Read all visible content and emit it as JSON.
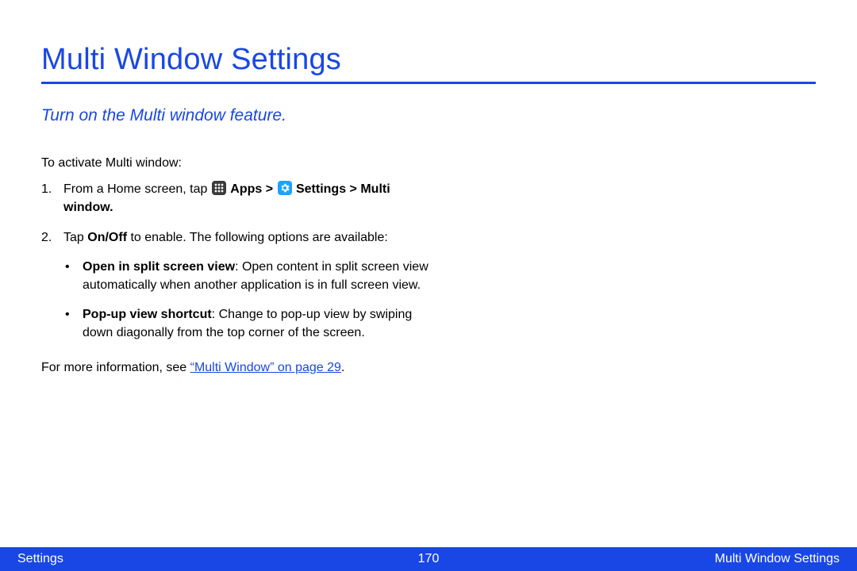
{
  "title": "Multi Window Settings",
  "subtitle": "Turn on the Multi window feature.",
  "intro": "To activate Multi window:",
  "step1": {
    "prefix": "From a Home screen, tap ",
    "apps_label": "Apps",
    "sep1": " > ",
    "settings_label": "Settings",
    "sep2": " > ",
    "multi_window_label": "Multi window."
  },
  "step2": {
    "prefix": "Tap ",
    "onoff_label": "On/Off",
    "suffix": " to enable. The following options are available:"
  },
  "bullets": [
    {
      "label": "Open in split screen view",
      "text": ": Open content in split screen view automatically when another application is in full screen view."
    },
    {
      "label": "Pop-up view shortcut",
      "text": ": Change to pop-up view by swiping down diagonally from the top corner of the screen."
    }
  ],
  "more_info_prefix": "For more information, see ",
  "more_info_link": "“Multi Window” on page 29",
  "more_info_suffix": ".",
  "footer": {
    "left": "Settings",
    "center": "170",
    "right": "Multi Window Settings"
  }
}
